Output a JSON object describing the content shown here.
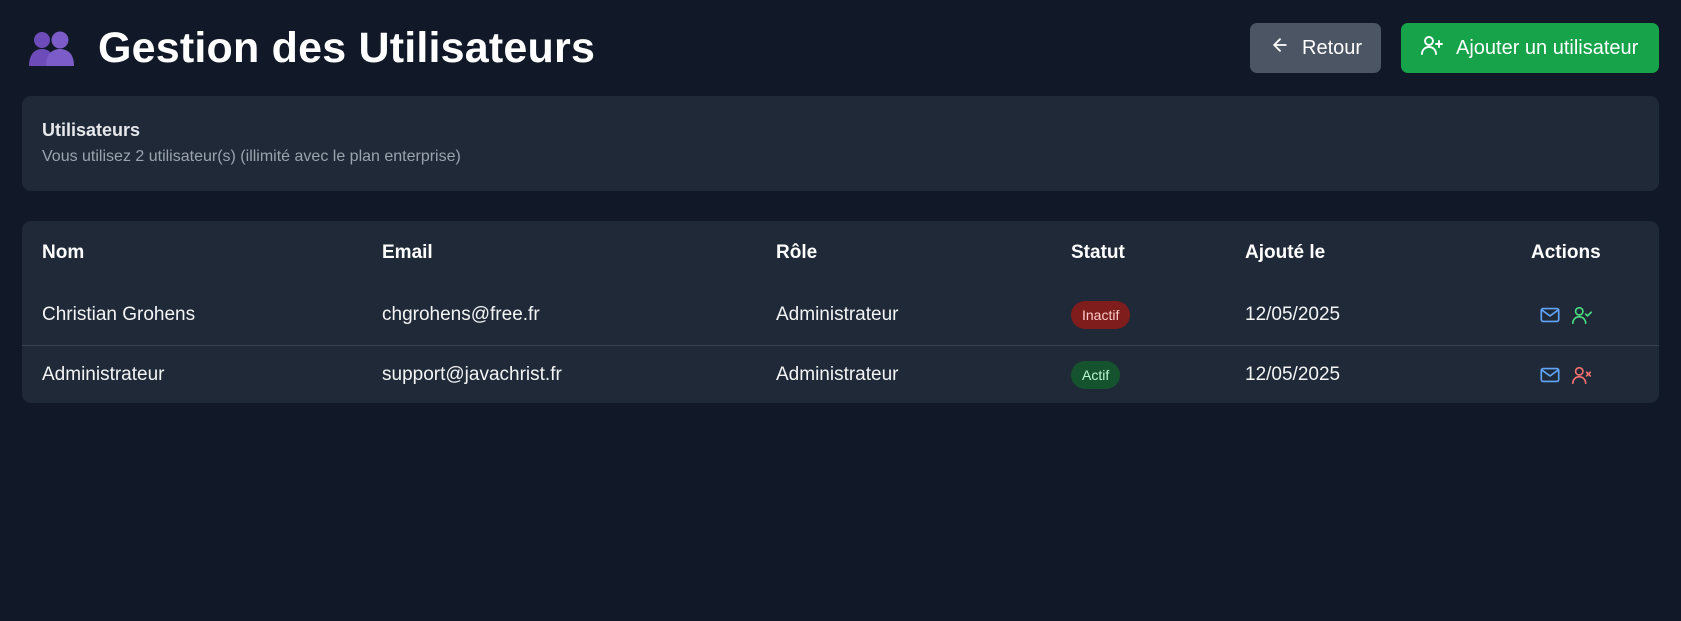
{
  "header": {
    "title": "Gestion des Utilisateurs",
    "title_icon": "users-icon",
    "back_label": "Retour",
    "back_icon": "arrow-left-icon",
    "add_label": "Ajouter un utilisateur",
    "add_icon": "user-plus-icon"
  },
  "info": {
    "title": "Utilisateurs",
    "subtitle": "Vous utilisez 2 utilisateur(s) (illimité avec le plan enterprise)"
  },
  "table": {
    "columns": [
      "Nom",
      "Email",
      "Rôle",
      "Statut",
      "Ajouté le",
      "Actions"
    ],
    "rows": [
      {
        "name": "Christian Grohens",
        "email": "chgrohens@free.fr",
        "role": "Administrateur",
        "status": "Inactif",
        "status_type": "inactive",
        "date": "12/05/2025",
        "action_icons": [
          "mail-icon",
          "user-check-icon"
        ]
      },
      {
        "name": "Administrateur",
        "email": "support@javachrist.fr",
        "role": "Administrateur",
        "status": "Actif",
        "status_type": "active",
        "date": "12/05/2025",
        "action_icons": [
          "mail-icon",
          "user-x-icon"
        ]
      }
    ]
  },
  "colors": {
    "background": "#111827",
    "card": "#1f2937",
    "back_button": "#4b5563",
    "add_button": "#16a34a",
    "badge_inactive": "#7f1d1d",
    "badge_active": "#14532d",
    "mail_icon": "#60a5fa",
    "user_check_icon": "#4ade80",
    "user_x_icon": "#f87171"
  }
}
